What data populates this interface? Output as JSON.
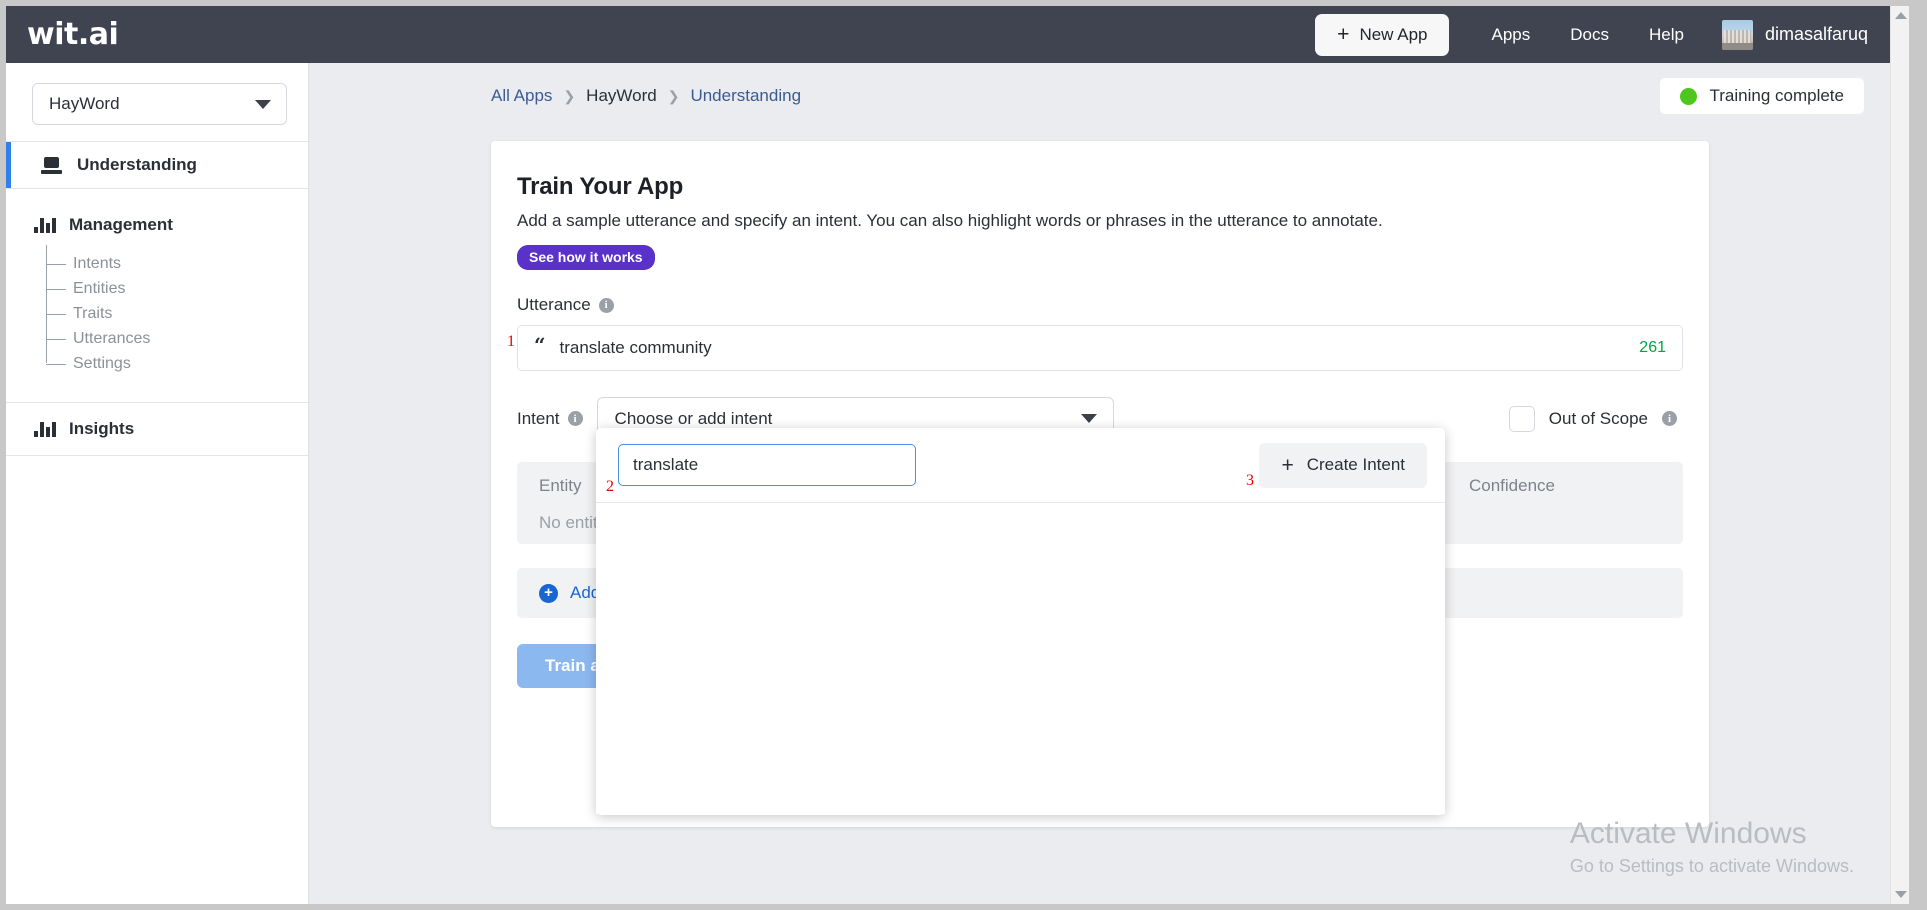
{
  "topnav": {
    "logo": "wit.ai",
    "new_app_label": "New App",
    "plus": "+",
    "links": [
      {
        "label": "Apps"
      },
      {
        "label": "Docs"
      },
      {
        "label": "Help"
      }
    ],
    "username": "dimasalfaruq"
  },
  "sidebar": {
    "app_selector": {
      "value": "HayWord"
    },
    "understanding": {
      "label": "Understanding"
    },
    "management": {
      "label": "Management",
      "items": [
        {
          "label": "Intents"
        },
        {
          "label": "Entities"
        },
        {
          "label": "Traits"
        },
        {
          "label": "Utterances"
        },
        {
          "label": "Settings"
        }
      ]
    },
    "insights": {
      "label": "Insights"
    }
  },
  "breadcrumb": {
    "items": [
      {
        "label": "All Apps"
      },
      {
        "label": "HayWord"
      },
      {
        "label": "Understanding"
      }
    ],
    "separator": "❯"
  },
  "training_status": {
    "label": "Training complete",
    "dot_color": "#4ec61e"
  },
  "card": {
    "title": "Train Your App",
    "subtitle": "Add a sample utterance and specify an intent. You can also highlight words or phrases in the utterance to annotate.",
    "pill_label": "See how it works",
    "utterance": {
      "label": "Utterance",
      "quote_glyph": "“",
      "value": "translate community",
      "char_count": "261",
      "char_count_color": "#00a63f"
    },
    "intent": {
      "label": "Intent",
      "placeholder": "Choose or add intent"
    },
    "out_of_scope": {
      "label": "Out of Scope"
    },
    "entity_table": {
      "columns": [
        {
          "label": "Entity"
        },
        {
          "label": "Confidence"
        }
      ],
      "empty_text": "No entities"
    },
    "add_row": {
      "label": "Add Entity"
    },
    "train_button": {
      "label": "Train and Validate"
    },
    "info_glyph": "i"
  },
  "intent_dropdown": {
    "search_value": "translate",
    "create_label": "Create Intent",
    "create_plus": "+"
  },
  "markers": {
    "m1": "1",
    "m2": "2",
    "m3": "3"
  },
  "watermark": {
    "line1": "Activate Windows",
    "line2": "Go to Settings to activate Windows."
  }
}
